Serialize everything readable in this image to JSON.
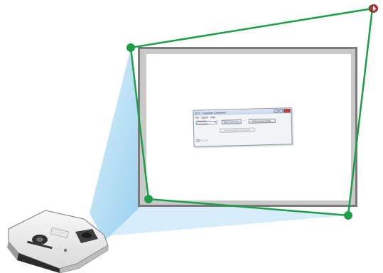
{
  "app_window": {
    "title": "GCT - Keystone Correction",
    "menu": [
      "File",
      "Option",
      "Help"
    ],
    "mode_select_value": "Keystone Correction",
    "start_button": "Start Correction",
    "perf_button": "Performance Field...",
    "apply_button": "Start Keystone Correction",
    "checkbox_label": "Pin-point"
  },
  "colors": {
    "frame_green": "#1f9e49",
    "beam_blue": "#9fd3f0",
    "screen_border": "#7a7a7a",
    "screen_fill": "#ffffff",
    "cursor_red": "#d8262b"
  }
}
